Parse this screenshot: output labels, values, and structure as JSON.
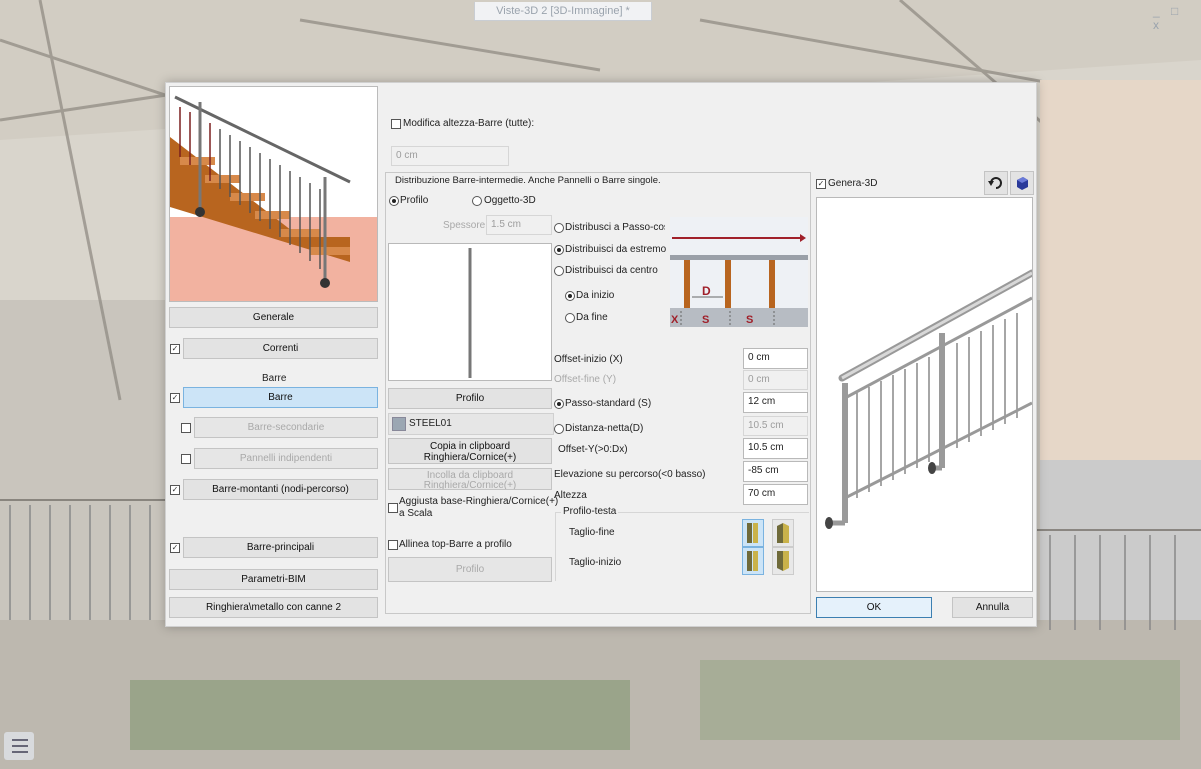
{
  "window": {
    "title": "Viste-3D 2 [3D-Immagine] *",
    "controls": "_ □ x"
  },
  "left": {
    "buttons": {
      "generale": "Generale",
      "correnti": "Correnti",
      "barre": "Barre",
      "barre_secondarie": "Barre-secondarie",
      "pannelli_indipendenti": "Pannelli indipendenti",
      "barre_montanti": "Barre-montanti (nodi-percorso)",
      "barre_principali": "Barre-principali",
      "parametri_bim": "Parametri-BIM",
      "ringhiera": "Ringhiera\\metallo con canne 2"
    },
    "section_barre": "Barre",
    "check_mark": "✓"
  },
  "middle": {
    "modifica_altezza": "Modifica altezza-Barre (tutte):",
    "altezza_value": "0 cm",
    "distribuzione_title": "Distribuzione Barre-intermedie. Anche Pannelli o Barre singole.",
    "radio_profilo": "Profilo",
    "radio_oggetto3d": "Oggetto-3D",
    "spessore_label": "Spessore",
    "spessore_value": "1.5 cm",
    "profilo_button": "Profilo",
    "material": "STEEL01",
    "copia_line1": "Copia in clipboard",
    "copia_line2": "Ringhiera/Cornice(+)",
    "incolla_line1": "Incolla da clipboard",
    "incolla_line2": "Ringhiera/Cornice(+)",
    "aggiusta_line1": "Aggiusta base-Ringhiera/Cornice(+)",
    "aggiusta_line2": "a Scala",
    "allinea": "Allinea top-Barre a profilo",
    "profilo_button2": "Profilo"
  },
  "distribution": {
    "passo_costante": "Distribusci a Passo-costante",
    "da_estremo": "Distribuisci da estremo",
    "da_centro": "Distribuisci da centro",
    "da_inizio": "Da inizio",
    "da_fine": "Da fine",
    "diagram_labels": {
      "d": "D",
      "x": "X",
      "s1": "S",
      "s2": "S"
    }
  },
  "params": {
    "offset_inizio_label": "Offset-inizio (X)",
    "offset_inizio_value": "0 cm",
    "offset_fine_label": "Offset-fine (Y)",
    "offset_fine_value": "0 cm",
    "passo_standard_label": "Passo-standard (S)",
    "passo_standard_value": "12 cm",
    "distanza_netta_label": "Distanza-netta(D)",
    "distanza_netta_value": "10.5 cm",
    "offset_y_label": "Offset-Y(>0:Dx)",
    "offset_y_value": "10.5 cm",
    "elevazione_label": "Elevazione su percorso(<0 basso)",
    "elevazione_value": "-85 cm",
    "altezza_label": "Altezza",
    "altezza_value": "70 cm",
    "profilo_testa": "Profilo-testa",
    "taglio_fine": "Taglio-fine",
    "taglio_inizio": "Taglio-inizio"
  },
  "right": {
    "genera3d": "Genera-3D",
    "ok": "OK",
    "annulla": "Annulla"
  },
  "colors": {
    "accent": "#7ab3e0",
    "selected_bg": "#cce4f7",
    "diagram_red": "#a0202a",
    "wood": "#b8651f"
  }
}
